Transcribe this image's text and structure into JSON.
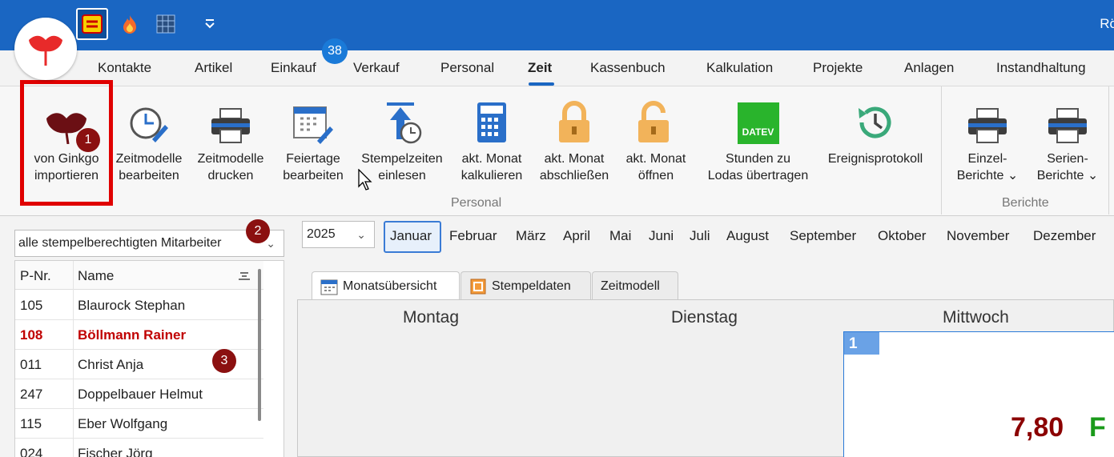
{
  "title_bar": {
    "user_text": "Rö"
  },
  "nav": {
    "tabs": [
      "Kontakte",
      "Artikel",
      "Einkauf",
      "Verkauf",
      "Personal",
      "Zeit",
      "Kassenbuch",
      "Kalkulation",
      "Projekte",
      "Anlagen",
      "Instandhaltung"
    ],
    "active": "Zeit",
    "badge": "38"
  },
  "ribbon": {
    "personal_buttons": [
      {
        "line1": "von Ginkgo",
        "line2": "importieren",
        "icon": "ginkgo-leaf-icon"
      },
      {
        "line1": "Zeitmodelle",
        "line2": "bearbeiten",
        "icon": "clock-edit-icon"
      },
      {
        "line1": "Zeitmodelle",
        "line2": "drucken",
        "icon": "printer-icon"
      },
      {
        "line1": "Feiertage",
        "line2": "bearbeiten",
        "icon": "calendar-edit-icon"
      },
      {
        "line1": "Stempelzeiten",
        "line2": "einlesen",
        "icon": "import-clock-icon"
      },
      {
        "line1": "akt. Monat",
        "line2": "kalkulieren",
        "icon": "calculator-icon"
      },
      {
        "line1": "akt. Monat",
        "line2": "abschließen",
        "icon": "lock-closed-icon"
      },
      {
        "line1": "akt. Monat",
        "line2": "öffnen",
        "icon": "lock-open-icon"
      },
      {
        "line1": "Stunden zu",
        "line2": "Lodas übertragen",
        "icon": "datev-icon"
      },
      {
        "line1": "Ereignisprotokoll",
        "line2": "",
        "icon": "history-clock-icon"
      }
    ],
    "datev_text": "DATEV",
    "group_personal": "Personal",
    "berichte_buttons": [
      {
        "line1": "Einzel-",
        "line2": "Berichte ⌄"
      },
      {
        "line1": "Serien-",
        "line2": "Berichte ⌄"
      }
    ],
    "group_berichte": "Berichte"
  },
  "steps": [
    "1",
    "2",
    "3"
  ],
  "employees": {
    "filter": "alle stempelberechtigten Mitarbeiter",
    "columns": [
      "P-Nr.",
      "Name"
    ],
    "rows": [
      {
        "nr": "105",
        "name": "Blaurock Stephan"
      },
      {
        "nr": "108",
        "name": "Böllmann Rainer"
      },
      {
        "nr": "011",
        "name": "Christ Anja"
      },
      {
        "nr": "247",
        "name": "Doppelbauer Helmut"
      },
      {
        "nr": "115",
        "name": "Eber Wolfgang"
      },
      {
        "nr": "024",
        "name": "Fischer Jörg"
      }
    ]
  },
  "period": {
    "year": "2025",
    "months": [
      "Januar",
      "Februar",
      "März",
      "April",
      "Mai",
      "Juni",
      "Juli",
      "August",
      "September",
      "Oktober",
      "November",
      "Dezember"
    ],
    "selected": "Januar"
  },
  "view_tabs": [
    "Monatsübersicht",
    "Stempeldaten",
    "Zeitmodell"
  ],
  "calendar": {
    "days": [
      "Montag",
      "Dienstag",
      "Mittwoch"
    ],
    "day_number": "1",
    "day_value": "7,80",
    "day_flag": "F"
  },
  "colors": {
    "accent": "#1a66c2",
    "highlight": "#e00000",
    "step": "#8b1010"
  }
}
